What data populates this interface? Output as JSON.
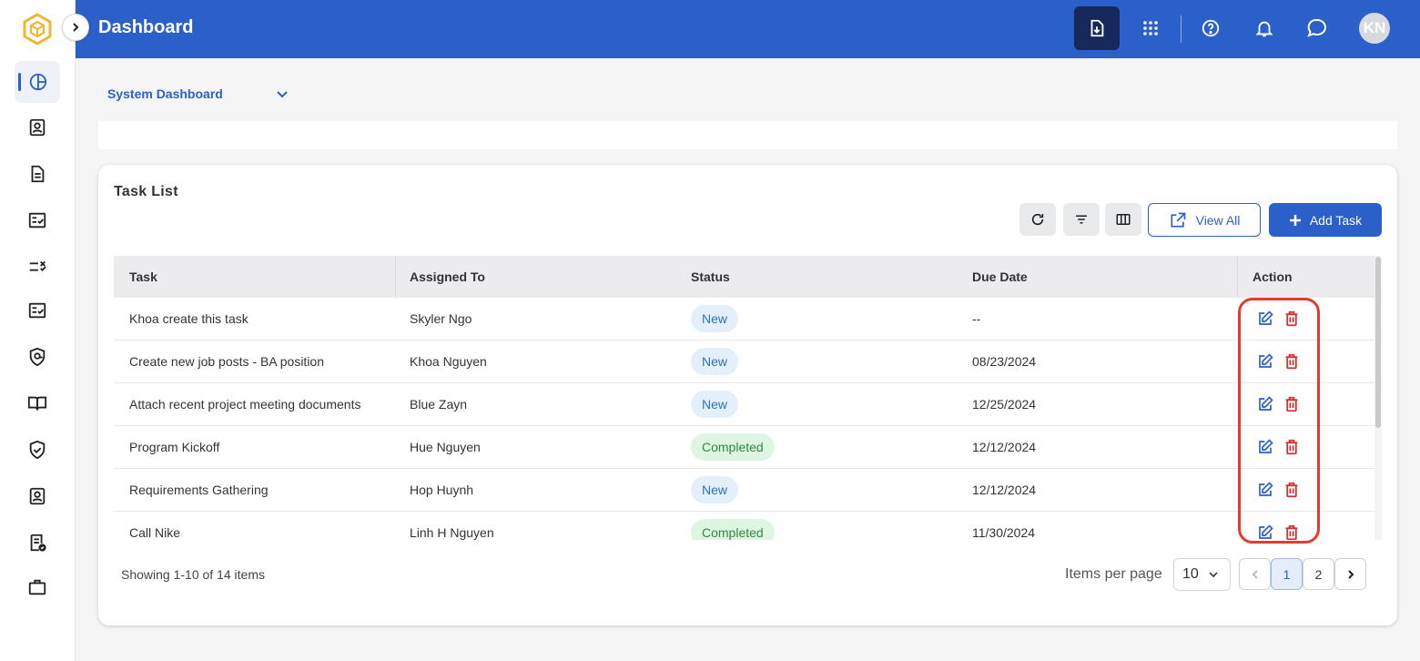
{
  "header": {
    "title": "Dashboard",
    "avatar_initials": "KN",
    "color": "#2b5fc9"
  },
  "sidebar": {
    "items": [
      {
        "icon": "dashboard-pie-icon",
        "active": true
      },
      {
        "icon": "contact-card-icon"
      },
      {
        "icon": "document-icon"
      },
      {
        "icon": "checklist-icon"
      },
      {
        "icon": "list-x-icon"
      },
      {
        "icon": "task-check-icon"
      },
      {
        "icon": "shield-at-icon"
      },
      {
        "icon": "book-icon"
      },
      {
        "icon": "shield-check-icon"
      },
      {
        "icon": "id-badge-icon"
      },
      {
        "icon": "report-check-icon"
      },
      {
        "icon": "briefcase-icon"
      }
    ]
  },
  "dashboard_select": {
    "value": "System Dashboard"
  },
  "task_list": {
    "title": "Task List",
    "view_all_label": "View All",
    "add_task_label": "Add Task",
    "columns": {
      "task": "Task",
      "assigned_to": "Assigned To",
      "status": "Status",
      "due_date": "Due Date",
      "action": "Action"
    },
    "rows": [
      {
        "task": "Khoa create this task",
        "assigned_to": "Skyler Ngo",
        "status": "New",
        "due_date": "--"
      },
      {
        "task": "Create new job posts - BA position",
        "assigned_to": "Khoa Nguyen",
        "status": "New",
        "due_date": "08/23/2024"
      },
      {
        "task": "Attach recent project meeting documents",
        "assigned_to": "Blue Zayn",
        "status": "New",
        "due_date": "12/25/2024"
      },
      {
        "task": "Program Kickoff",
        "assigned_to": "Hue Nguyen",
        "status": "Completed",
        "due_date": "12/12/2024"
      },
      {
        "task": "Requirements Gathering",
        "assigned_to": "Hop Huynh",
        "status": "New",
        "due_date": "12/12/2024"
      },
      {
        "task": "Call Nike",
        "assigned_to": "Linh H Nguyen",
        "status": "Completed",
        "due_date": "11/30/2024"
      }
    ],
    "footer": {
      "showing": "Showing 1-10 of 14 items",
      "items_per_page_label": "Items per page",
      "items_per_page_value": "10",
      "pages": [
        "1",
        "2"
      ],
      "current_page": "1"
    }
  }
}
